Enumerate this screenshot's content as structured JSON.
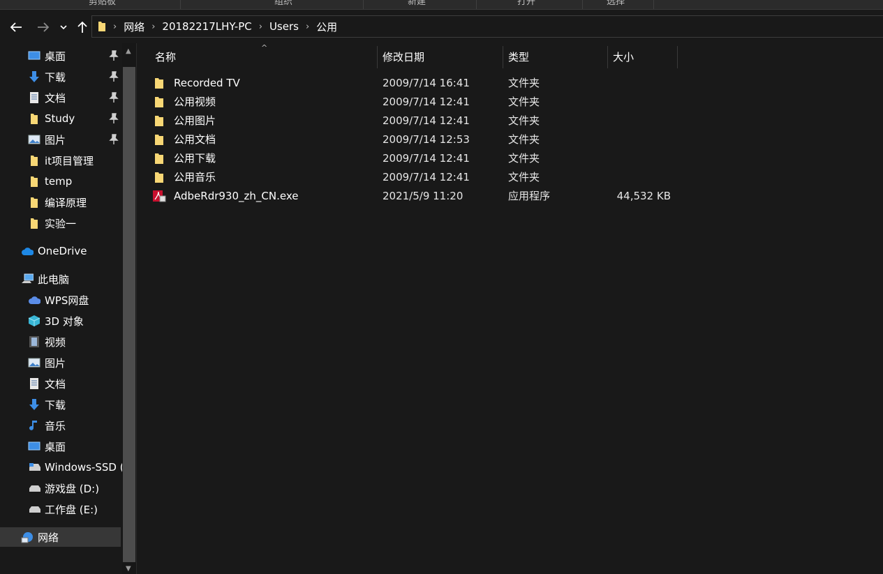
{
  "ribbon": {
    "labels": [
      "剪贴板",
      "组织",
      "新建",
      "打开",
      "选择"
    ]
  },
  "nav": {
    "back_icon": "arrow-left-icon",
    "forward_icon": "arrow-right-icon",
    "recent_icon": "chevron-down-icon",
    "up_icon": "arrow-up-icon"
  },
  "address": {
    "crumbs": [
      "网络",
      "20182217LHY-PC",
      "Users",
      "公用"
    ]
  },
  "sidebar": {
    "quick_access": [
      {
        "label": "桌面",
        "icon": "desktop-icon",
        "pinned": true
      },
      {
        "label": "下载",
        "icon": "download-icon",
        "pinned": true
      },
      {
        "label": "文档",
        "icon": "document-icon",
        "pinned": true
      },
      {
        "label": "Study",
        "icon": "folder-icon",
        "pinned": true
      },
      {
        "label": "图片",
        "icon": "pictures-icon",
        "pinned": true
      },
      {
        "label": "it项目管理",
        "icon": "folder-icon",
        "pinned": false
      },
      {
        "label": "temp",
        "icon": "folder-icon",
        "pinned": false
      },
      {
        "label": "编译原理",
        "icon": "folder-icon",
        "pinned": false
      },
      {
        "label": "实验一",
        "icon": "folder-icon",
        "pinned": false
      }
    ],
    "onedrive": {
      "label": "OneDrive",
      "icon": "cloud-icon"
    },
    "this_pc": {
      "label": "此电脑",
      "icon": "computer-icon"
    },
    "pc_items": [
      {
        "label": "WPS网盘",
        "icon": "cloud-icon"
      },
      {
        "label": "3D 对象",
        "icon": "cube-icon"
      },
      {
        "label": "视频",
        "icon": "video-icon"
      },
      {
        "label": "图片",
        "icon": "pictures-icon"
      },
      {
        "label": "文档",
        "icon": "document-icon"
      },
      {
        "label": "下载",
        "icon": "download-icon"
      },
      {
        "label": "音乐",
        "icon": "music-icon"
      },
      {
        "label": "桌面",
        "icon": "desktop-icon"
      },
      {
        "label": "Windows-SSD (",
        "icon": "drive-icon"
      },
      {
        "label": "游戏盘 (D:)",
        "icon": "drive-icon"
      },
      {
        "label": "工作盘 (E:)",
        "icon": "drive-icon"
      }
    ],
    "network": {
      "label": "网络",
      "icon": "network-icon",
      "selected": true
    }
  },
  "columns": {
    "name": "名称",
    "date": "修改日期",
    "type": "类型",
    "size": "大小"
  },
  "files": [
    {
      "name": "Recorded TV",
      "date": "2009/7/14 16:41",
      "type": "文件夹",
      "size": "",
      "icon": "folder-icon"
    },
    {
      "name": "公用视频",
      "date": "2009/7/14 12:41",
      "type": "文件夹",
      "size": "",
      "icon": "folder-icon"
    },
    {
      "name": "公用图片",
      "date": "2009/7/14 12:41",
      "type": "文件夹",
      "size": "",
      "icon": "folder-icon"
    },
    {
      "name": "公用文档",
      "date": "2009/7/14 12:53",
      "type": "文件夹",
      "size": "",
      "icon": "folder-icon"
    },
    {
      "name": "公用下载",
      "date": "2009/7/14 12:41",
      "type": "文件夹",
      "size": "",
      "icon": "folder-icon"
    },
    {
      "name": "公用音乐",
      "date": "2009/7/14 12:41",
      "type": "文件夹",
      "size": "",
      "icon": "folder-icon"
    },
    {
      "name": "AdbeRdr930_zh_CN.exe",
      "date": "2021/5/9 11:20",
      "type": "应用程序",
      "size": "44,532 KB",
      "icon": "acrobat-installer-icon"
    }
  ],
  "colors": {
    "background": "#191919",
    "folder": "#f8d775",
    "accent_blue": "#3d8ee6",
    "selected": "#373737"
  }
}
